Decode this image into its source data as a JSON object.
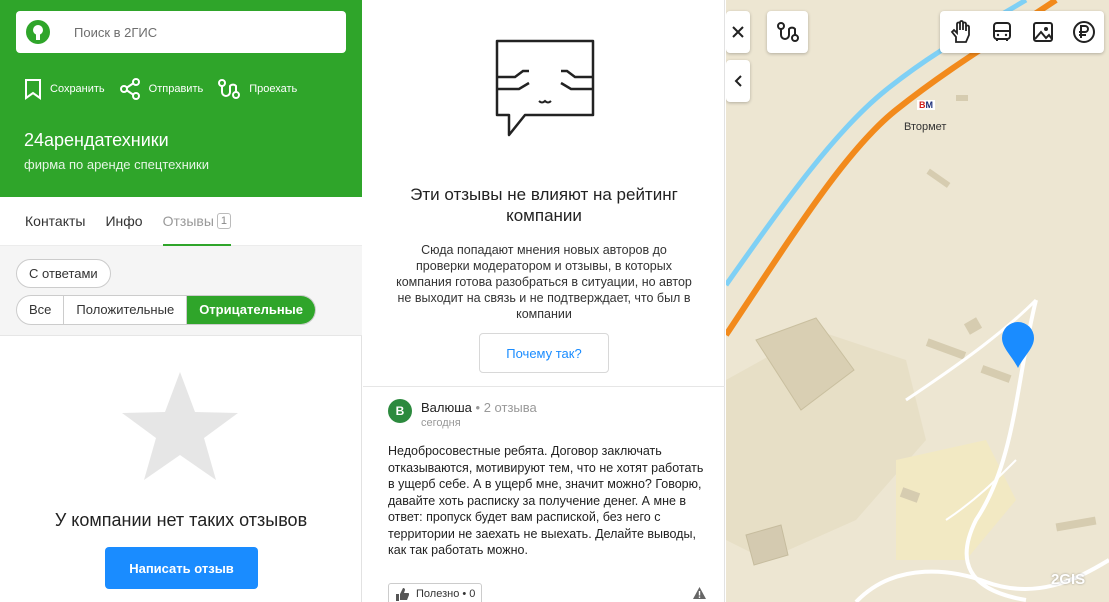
{
  "search": {
    "placeholder": "Поиск в 2ГИС"
  },
  "actions": {
    "save": "Сохранить",
    "share": "Отправить",
    "route": "Проехать"
  },
  "company": {
    "name": "24арендатехники",
    "subtitle": "фирма по аренде спецтехники"
  },
  "tabs": [
    {
      "label": "Контакты"
    },
    {
      "label": "Инфо"
    },
    {
      "label": "Отзывы",
      "count": "1"
    }
  ],
  "filters": {
    "with_answers": "С ответами",
    "segments": [
      "Все",
      "Положительные",
      "Отрицательные"
    ],
    "active_segment": "Отрицательные"
  },
  "empty": {
    "text": "У компании нет таких отзывов",
    "write_button": "Написать отзыв"
  },
  "notice": {
    "title": "Эти отзывы не влияют на рейтинг компании",
    "description": "Сюда попадают мнения новых авторов до проверки модератором и отзывы, в которых компания готова разобраться в ситуации, но автор не выходит на связь и не подтверждает, что был в компании",
    "why_button": "Почему так?"
  },
  "review": {
    "avatar_letter": "В",
    "author": "Валюша",
    "author_reviews": "2 отзыва",
    "date": "сегодня",
    "text": "Недобросовестные ребята. Договор заключать отказываются, мотивируют тем, что не хотят работать в ущерб себе. А в ущерб мне, значит можно? Говорю, давайте хоть расписку за получение денег. А мне в ответ: пропуск будет вам распиской, без него с территории не заехать не выехать. Делайте выводы, как так работать можно.",
    "useful_label": "Полезно",
    "useful_count": "0"
  },
  "map": {
    "poi_logo_left": "В",
    "poi_logo_right": "М",
    "poi_name": "Втормет",
    "watermark": "2GIS",
    "icons": [
      "close-icon",
      "route-icon",
      "collapse-icon",
      "hand-icon",
      "bus-icon",
      "photo-icon",
      "ruble-icon"
    ]
  },
  "colors": {
    "brand_green": "#2fa52a",
    "accent_blue": "#1a8cff",
    "marker_blue": "#1a8cff"
  }
}
